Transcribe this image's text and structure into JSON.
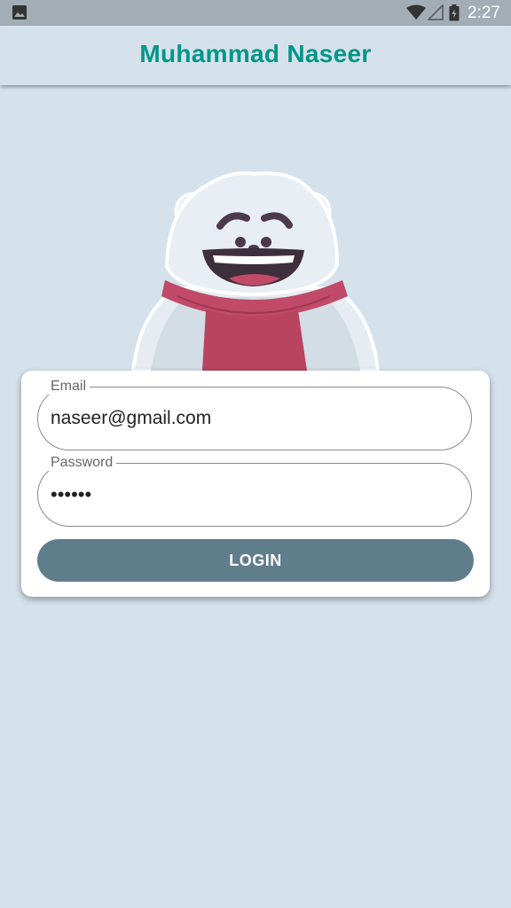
{
  "status_bar": {
    "time": "2:27",
    "icons": [
      "image-icon",
      "wifi-icon",
      "signal-icon",
      "battery-icon"
    ]
  },
  "app_bar": {
    "title": "Muhammad Naseer",
    "title_color": "#009688"
  },
  "login_form": {
    "email_label": "Email",
    "email_value": "naseer@gmail.com",
    "password_label": "Password",
    "password_value": "••••••",
    "login_label": "LOGIN",
    "button_color": "#607d8b"
  },
  "mascot": "polar-bear-mascot"
}
